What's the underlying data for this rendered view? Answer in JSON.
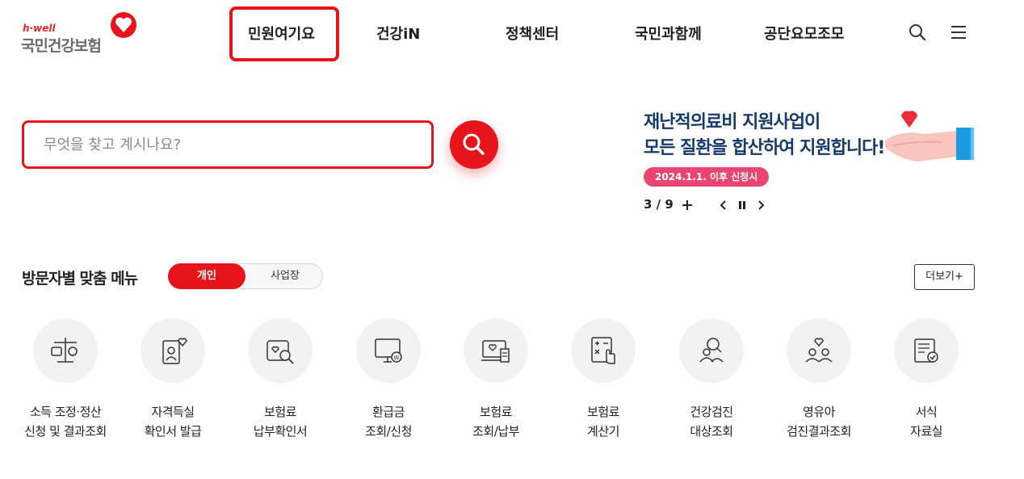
{
  "logo": {
    "tagline": "h·well",
    "name": "국민건강보험"
  },
  "gnb": [
    {
      "label": "민원여기요"
    },
    {
      "label": "건강iN"
    },
    {
      "label": "정책센터"
    },
    {
      "label": "국민과함께"
    },
    {
      "label": "공단요모조모"
    }
  ],
  "header_icons": [
    "search-icon",
    "menu-icon"
  ],
  "search": {
    "placeholder": "무엇을 찾고 계시나요?",
    "value": ""
  },
  "banner": {
    "title_line1": "재난적의료비 지원사업이",
    "title_line2": "모든 질환을 합산하여 지원합니다!",
    "badge": "2024.1.1. 이후 신청시",
    "pager": "3 / 9"
  },
  "section": {
    "title": "방문자별 맞춤 메뉴",
    "toggle_active": "개인",
    "toggle_inactive": "사업장",
    "more": "더보기+"
  },
  "menus": [
    {
      "line1": "소득 조정·정산",
      "line2": "신청 및 결과조회",
      "icon": "scale-icon"
    },
    {
      "line1": "자격득실",
      "line2": "확인서 발급",
      "icon": "certificate-icon"
    },
    {
      "line1": "보험료",
      "line2": "납부확인서",
      "icon": "payment-search-icon"
    },
    {
      "line1": "환급금",
      "line2": "조회/신청",
      "icon": "refund-monitor-icon"
    },
    {
      "line1": "보험료",
      "line2": "조회/납부",
      "icon": "laptop-document-icon"
    },
    {
      "line1": "보험료",
      "line2": "계산기",
      "icon": "calculator-icon"
    },
    {
      "line1": "건강검진",
      "line2": "대상조회",
      "icon": "people-search-icon"
    },
    {
      "line1": "영유아",
      "line2": "검진결과조회",
      "icon": "family-heart-icon"
    },
    {
      "line1": "서식",
      "line2": "자료실",
      "icon": "form-check-icon"
    }
  ],
  "colors": {
    "accent": "#e8141b",
    "banner_text": "#153a6b",
    "badge": "#e84670"
  }
}
